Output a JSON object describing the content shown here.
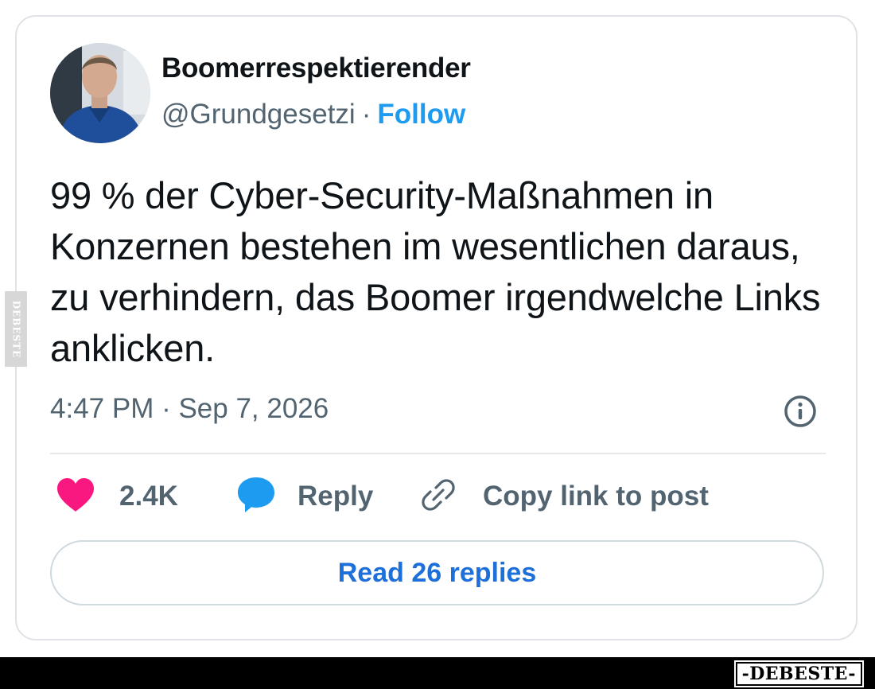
{
  "tweet": {
    "display_name": "Boomerrespektierender",
    "handle": "@Grundgesetzi",
    "separator": "·",
    "follow_label": "Follow",
    "text": "99 % der Cyber-Security-Maßnahmen in Konzernen bestehen im wesentlichen daraus, zu verhindern, das Boomer irgendwelche Links anklicken.",
    "timestamp": "4:47 PM · Sep 7, 2026",
    "info_icon": "info-icon"
  },
  "actions": {
    "like_count": "2.4K",
    "like_icon": "heart-icon",
    "reply_label": "Reply",
    "reply_icon": "speech-bubble-icon",
    "copy_label": "Copy link to post",
    "copy_icon": "link-icon"
  },
  "read_replies_label": "Read 26 replies",
  "watermark": {
    "side_text": "DEBESTE",
    "footer_text": "-DEBESTE-"
  },
  "colors": {
    "follow": "#1d9bf0",
    "heart": "#f91880",
    "reply_bubble": "#1d9bf0",
    "secondary_text": "#536471",
    "read_replies": "#1d6fd9"
  }
}
